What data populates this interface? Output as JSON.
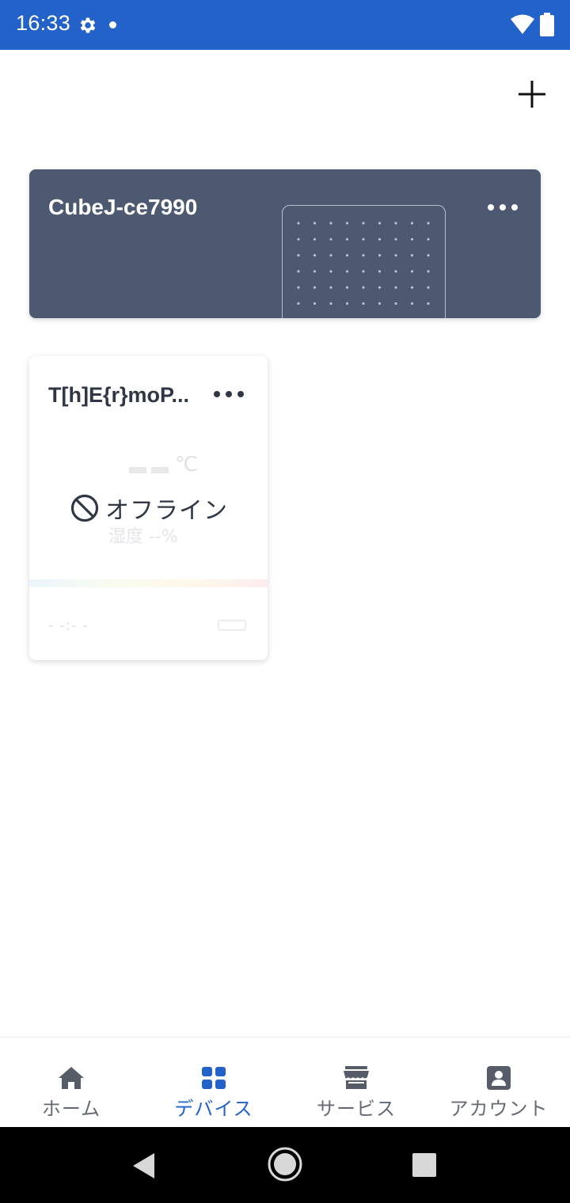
{
  "status_bar": {
    "time": "16:33",
    "icons": [
      "gear-icon",
      "notification-dot-icon",
      "wifi-icon",
      "battery-icon"
    ],
    "color": "#2362c8"
  },
  "header": {
    "add_icon": "plus-icon"
  },
  "devices": [
    {
      "name": "CubeJ-ce7990",
      "more_icon": "more-horizontal-icon",
      "card_color": "#4d5970"
    },
    {
      "name": "T[h]E{r}moP...",
      "more_icon": "more-horizontal-icon",
      "status": "オフライン",
      "status_icon": "prohibited-icon",
      "temp_unit": "℃",
      "humidity": "湿度 --%",
      "last_updated": "- -:- -"
    }
  ],
  "bottom_nav": {
    "items": [
      {
        "label": "ホーム",
        "icon": "home-icon",
        "active": false
      },
      {
        "label": "デバイス",
        "icon": "devices-grid-icon",
        "active": true
      },
      {
        "label": "サービス",
        "icon": "store-icon",
        "active": false
      },
      {
        "label": "アカウント",
        "icon": "account-icon",
        "active": false
      }
    ],
    "active_color": "#2362c8"
  },
  "system_nav": {
    "icons": [
      "back-icon",
      "home-circle-icon",
      "recents-icon"
    ]
  }
}
